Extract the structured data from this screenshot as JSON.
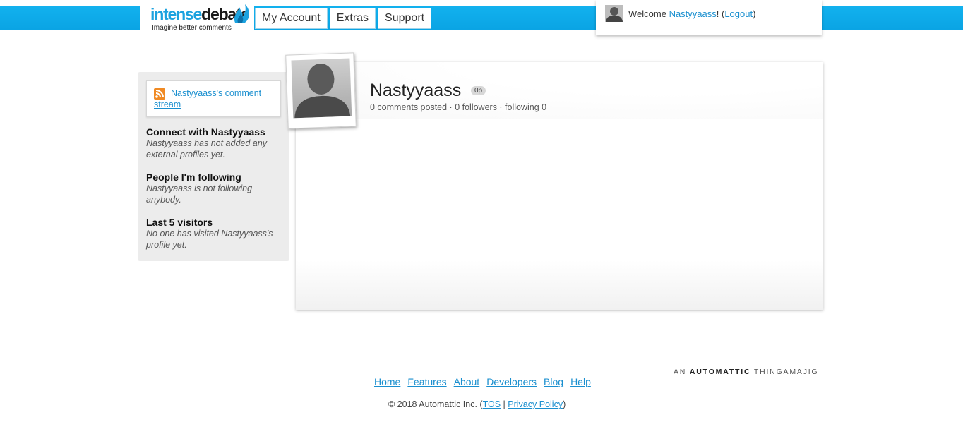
{
  "header": {
    "logo_part1": "intense",
    "logo_part2": "debate",
    "tagline": "Imagine better comments",
    "nav": [
      "My Account",
      "Extras",
      "Support"
    ],
    "welcome": {
      "prefix": "Welcome ",
      "username": "Nastyyaass",
      "mid": "! (",
      "logout": "Logout",
      "suffix": ")"
    }
  },
  "sidebar": {
    "rss_link": "Nastyyaass's comment stream",
    "sections": [
      {
        "heading": "Connect with Nastyyaass",
        "note": "Nastyyaass has not added any external profiles yet."
      },
      {
        "heading": "People I'm following",
        "note": "Nastyyaass is not following anybody."
      },
      {
        "heading": "Last 5 visitors",
        "note": "No one has visited Nastyyaass's profile yet."
      }
    ]
  },
  "profile": {
    "name": "Nastyyaass",
    "points": "0p",
    "stats": "0 comments posted · 0 followers · following 0"
  },
  "footer": {
    "brand_prefix": "AN ",
    "brand_name": "AUTOMATTIC",
    "brand_suffix": " THINGAMAJIG",
    "links": [
      "Home",
      "Features",
      "About",
      "Developers",
      "Blog",
      "Help"
    ],
    "copyright_prefix": "© 2018 Automattic Inc. (",
    "tos": "TOS",
    "sep": " | ",
    "privacy": "Privacy Policy",
    "copyright_suffix": ")"
  },
  "colors": {
    "topbar": "#0aa4e4",
    "link": "#1a8fcf",
    "rss": "#f08a24"
  }
}
